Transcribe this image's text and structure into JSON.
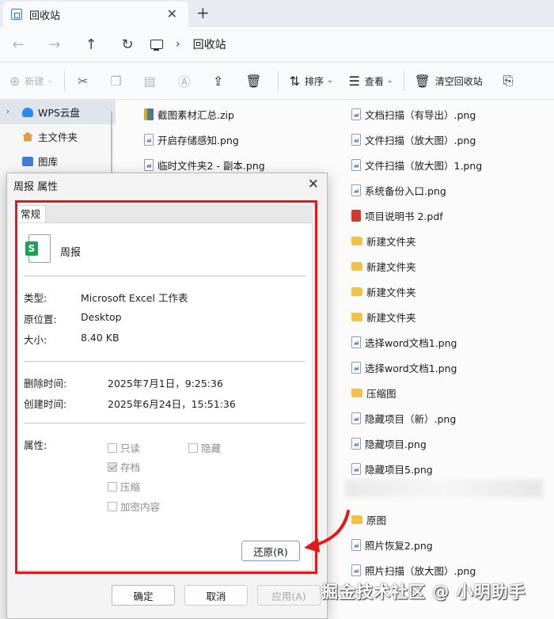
{
  "tab": {
    "title": "回收站",
    "close": "✕",
    "new_tab": "+"
  },
  "nav": {
    "back": "←",
    "forward": "→",
    "up": "↑",
    "refresh": "↻",
    "separator": "›",
    "location": "回收站"
  },
  "toolbar": {
    "new_label": "新建",
    "sort_label": "排序",
    "view_label": "查看",
    "empty_label": "清空回收站"
  },
  "sidebar": {
    "items": [
      {
        "label": "WPS云盘",
        "icon": "cloud-icon"
      },
      {
        "label": "主文件夹",
        "icon": "home-icon"
      },
      {
        "label": "图库",
        "icon": "pictures-icon"
      }
    ]
  },
  "files": {
    "left": [
      {
        "name": "截图素材汇总.zip",
        "type": "zip"
      },
      {
        "name": "开启存储感知.png",
        "type": "png"
      },
      {
        "name": "临时文件夹2 - 副本.png",
        "type": "png"
      }
    ],
    "right": [
      {
        "name": "文档扫描（有导出）.png",
        "type": "png"
      },
      {
        "name": "文件扫描（放大图）.png",
        "type": "png"
      },
      {
        "name": "文件扫描（放大图）1.png",
        "type": "png"
      },
      {
        "name": "系统备份入口.png",
        "type": "png"
      },
      {
        "name": "项目说明书 2.pdf",
        "type": "pdf"
      },
      {
        "name": "新建文件夹",
        "type": "folder"
      },
      {
        "name": "新建文件夹",
        "type": "folder"
      },
      {
        "name": "新建文件夹",
        "type": "folder"
      },
      {
        "name": "新建文件夹",
        "type": "folder"
      },
      {
        "name": "选择word文档1.png",
        "type": "png"
      },
      {
        "name": "选择word文档1.png",
        "type": "png"
      },
      {
        "name": "压缩图",
        "type": "folder"
      },
      {
        "name": "隐藏项目（新）.png",
        "type": "png"
      },
      {
        "name": "隐藏项目.png",
        "type": "png"
      },
      {
        "name": "隐藏项目5.png",
        "type": "png"
      },
      {
        "name": "原图",
        "type": "folder"
      },
      {
        "name": "照片恢复2.png",
        "type": "png"
      },
      {
        "name": "照片扫描（放大图）.png",
        "type": "png"
      }
    ]
  },
  "dialog": {
    "title": "周报 属性",
    "close": "✕",
    "tab_general": "常规",
    "file_name": "周报",
    "type_label": "类型:",
    "type_value": "Microsoft Excel 工作表",
    "location_label": "原位置:",
    "location_value": "Desktop",
    "size_label": "大小:",
    "size_value": "8.40 KB",
    "deleted_label": "删除时间:",
    "deleted_value": "2025年7月1日，9:25:36",
    "created_label": "创建时间:",
    "created_value": "2025年6月24日，15:51:36",
    "attributes_label": "属性:",
    "attributes": {
      "readonly": {
        "label": "只读",
        "checked": false
      },
      "hidden": {
        "label": "隐藏",
        "checked": false
      },
      "archive": {
        "label": "存档",
        "checked": true
      },
      "compress": {
        "label": "压缩",
        "checked": false
      },
      "encrypt": {
        "label": "加密内容",
        "checked": false
      }
    },
    "restore_label": "还原(R)",
    "ok_label": "确定",
    "cancel_label": "取消",
    "apply_label": "应用(A)"
  },
  "watermark": "掘金技术社区 @ 小明助手",
  "colors": {
    "highlight_frame": "#e1191d",
    "excel_green": "#1e9f5a",
    "folder": "#f4c243",
    "pdf": "#d4372c"
  }
}
